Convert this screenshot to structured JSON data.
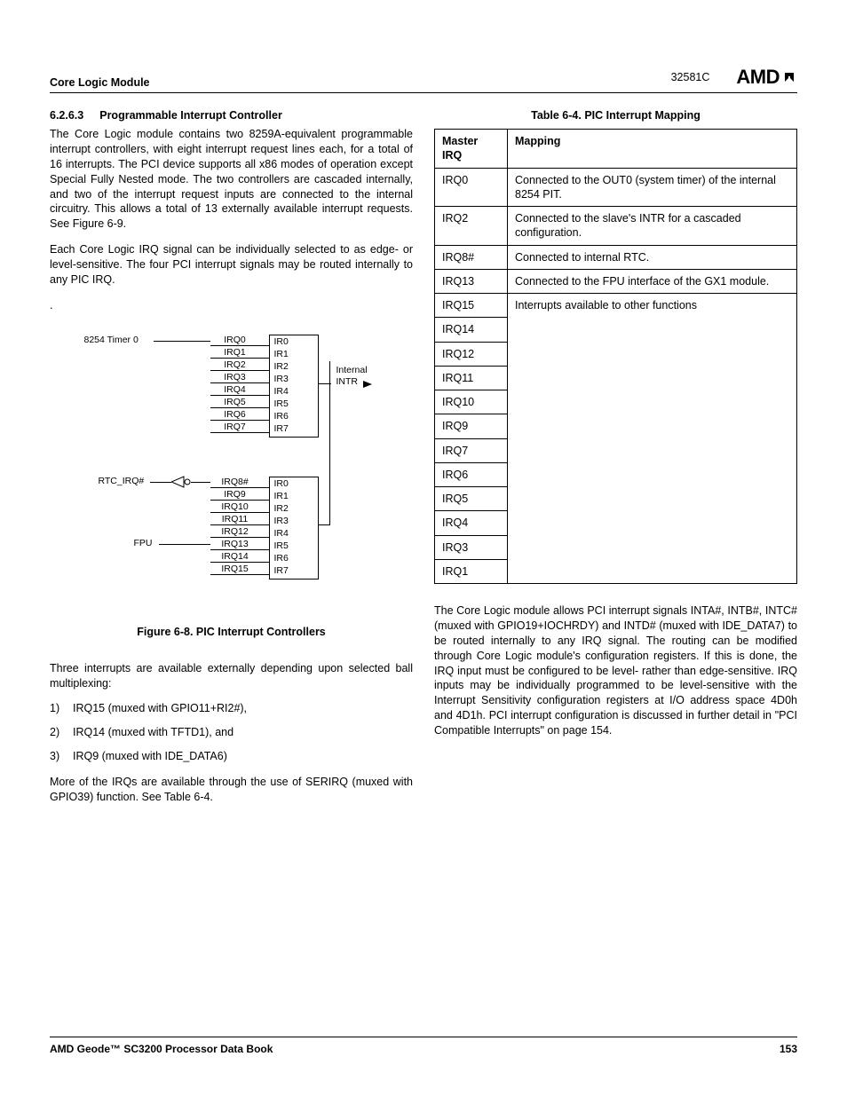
{
  "header": {
    "left": "Core Logic Module",
    "docnum": "32581C",
    "brand": "AMD"
  },
  "section": {
    "number": "6.2.6.3",
    "title": "Programmable Interrupt Controller",
    "para1": "The Core Logic module contains two 8259A-equivalent programmable interrupt controllers, with eight interrupt request lines each, for a total of 16 interrupts. The PCI device supports all x86 modes of operation except Special Fully Nested mode. The two controllers are cascaded internally, and two of the interrupt request inputs are connected to the internal circuitry. This allows a total of 13 externally available interrupt requests. See Figure 6-9.",
    "para2": "Each Core Logic IRQ signal can be individually selected to as edge- or level-sensitive. The four PCI interrupt signals may be routed internally to any PIC IRQ.",
    "period": "."
  },
  "figure": {
    "caption": "Figure 6-8.  PIC Interrupt Controllers",
    "labels": {
      "timer": "8254 Timer 0",
      "rtc": "RTC_IRQ#",
      "fpu": "FPU",
      "internal": "Internal",
      "intr": "INTR"
    },
    "upper_left": [
      "IRQ0",
      "IRQ1",
      "IRQ2",
      "IRQ3",
      "IRQ4",
      "IRQ5",
      "IRQ6",
      "IRQ7"
    ],
    "lower_left": [
      "IRQ8#",
      "IRQ9",
      "IRQ10",
      "IRQ11",
      "IRQ12",
      "IRQ13",
      "IRQ14",
      "IRQ15"
    ],
    "right_pins": [
      "IR0",
      "IR1",
      "IR2",
      "IR3",
      "IR4",
      "IR5",
      "IR6",
      "IR7"
    ]
  },
  "col1_tail": {
    "para": "Three interrupts are available externally depending upon selected ball multiplexing:",
    "items": [
      {
        "n": "1)",
        "t": "IRQ15 (muxed with GPIO11+RI2#),"
      },
      {
        "n": "2)",
        "t": "IRQ14 (muxed with TFTD1), and"
      },
      {
        "n": "3)",
        "t": "IRQ9 (muxed with IDE_DATA6)"
      }
    ],
    "para2": "More of the IRQs are available through the use of SERIRQ (muxed with GPIO39) function. See Table 6-4."
  },
  "table": {
    "title": "Table 6-4.  PIC Interrupt Mapping",
    "headers": {
      "c1": "Master IRQ",
      "c2": "Mapping"
    },
    "rows": [
      {
        "c1": "IRQ0",
        "c2": "Connected to the OUT0 (system timer) of the internal 8254 PIT."
      },
      {
        "c1": "IRQ2",
        "c2": "Connected to the slave's INTR for a cascaded configuration."
      },
      {
        "c1": "IRQ8#",
        "c2": "Connected to internal RTC."
      },
      {
        "c1": "IRQ13",
        "c2": "Connected to the FPU interface of the GX1 module."
      },
      {
        "c1": "IRQ15",
        "c2": "Interrupts available to other functions"
      },
      {
        "c1": "IRQ14",
        "c2": ""
      },
      {
        "c1": "IRQ12",
        "c2": ""
      },
      {
        "c1": "IRQ11",
        "c2": ""
      },
      {
        "c1": "IRQ10",
        "c2": ""
      },
      {
        "c1": "IRQ9",
        "c2": ""
      },
      {
        "c1": "IRQ7",
        "c2": ""
      },
      {
        "c1": "IRQ6",
        "c2": ""
      },
      {
        "c1": "IRQ5",
        "c2": ""
      },
      {
        "c1": "IRQ4",
        "c2": ""
      },
      {
        "c1": "IRQ3",
        "c2": ""
      },
      {
        "c1": "IRQ1",
        "c2": ""
      }
    ]
  },
  "col2_tail": {
    "para": "The Core Logic module allows PCI interrupt signals INTA#, INTB#, INTC# (muxed with GPIO19+IOCHRDY) and INTD# (muxed with IDE_DATA7) to be routed internally to any IRQ signal. The routing can be modified through Core Logic module's configuration registers. If this is done, the IRQ input must be configured to be level- rather than edge-sensitive. IRQ inputs may be individually programmed to be level-sensitive with the Interrupt Sensitivity configuration registers at I/O address space 4D0h and 4D1h. PCI interrupt configuration is discussed in further detail in \"PCI Compatible Interrupts\" on page 154."
  },
  "footer": {
    "left": "AMD Geode™ SC3200 Processor Data Book",
    "right": "153"
  }
}
